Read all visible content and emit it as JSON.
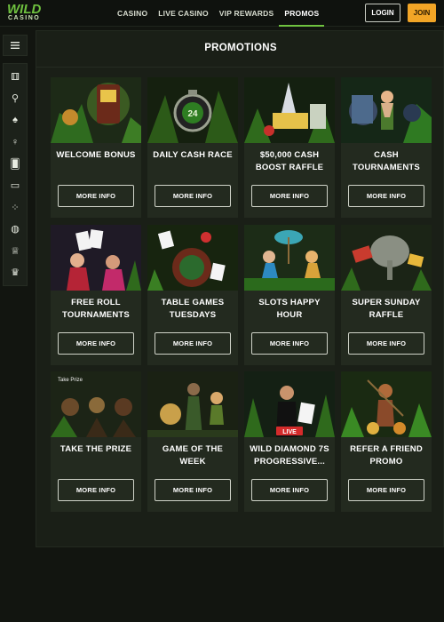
{
  "brand": {
    "logo_word": "WILD",
    "logo_sub": "CASINO"
  },
  "nav": {
    "items": [
      {
        "label": "CASINO"
      },
      {
        "label": "LIVE CASINO"
      },
      {
        "label": "VIP REWARDS"
      },
      {
        "label": "PROMOS",
        "active": true
      }
    ],
    "login_label": "LOGIN",
    "join_label": "JOIN"
  },
  "sidebar": {
    "menu_icon": "hamburger-icon",
    "items": [
      {
        "icon": "dice-icon",
        "glyph": "⚅"
      },
      {
        "icon": "cherries-icon",
        "glyph": "⚲"
      },
      {
        "icon": "spade-icon",
        "glyph": "♠"
      },
      {
        "icon": "dealer-icon",
        "glyph": "♀"
      },
      {
        "icon": "cards-icon",
        "glyph": "🂠"
      },
      {
        "icon": "laptop-icon",
        "glyph": "▭"
      },
      {
        "icon": "dots-icon",
        "glyph": "⁘"
      },
      {
        "icon": "basketball-icon",
        "glyph": "◍"
      },
      {
        "icon": "trophy-icon",
        "glyph": "♕"
      },
      {
        "icon": "crown-icon",
        "glyph": "♛"
      }
    ]
  },
  "page": {
    "title": "PROMOTIONS"
  },
  "promos": [
    {
      "title": "WELCOME BONUS",
      "button": "MORE INFO"
    },
    {
      "title": "DAILY CASH RACE",
      "button": "MORE INFO"
    },
    {
      "title": "$50,000 CASH BOOST RAFFLE",
      "button": "MORE INFO"
    },
    {
      "title": "CASH TOURNAMENTS",
      "button": "MORE INFO"
    },
    {
      "title": "FREE ROLL TOURNAMENTS",
      "button": "MORE INFO"
    },
    {
      "title": "TABLE GAMES TUESDAYS",
      "button": "MORE INFO"
    },
    {
      "title": "SLOTS HAPPY HOUR",
      "button": "MORE INFO"
    },
    {
      "title": "SUPER SUNDAY RAFFLE",
      "button": "MORE INFO"
    },
    {
      "title": "TAKE THE PRIZE",
      "button": "MORE INFO",
      "thumb_text": "Take Prize"
    },
    {
      "title": "GAME OF THE WEEK",
      "button": "MORE INFO"
    },
    {
      "title": "WILD DIAMOND 7S PROGRESSIVE...",
      "button": "MORE INFO",
      "thumb_text": "LIVE"
    },
    {
      "title": "REFER A FRIEND PROMO",
      "button": "MORE INFO"
    }
  ],
  "colors": {
    "accent": "#6fc23f",
    "join": "#f2a526",
    "panel": "#1a1f17",
    "card": "#232a1f"
  }
}
